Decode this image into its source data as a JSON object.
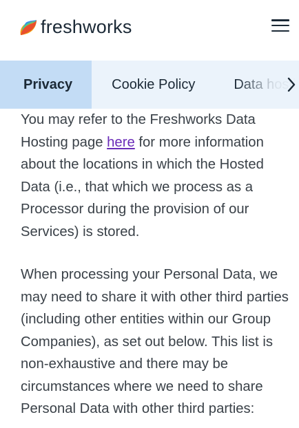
{
  "header": {
    "logo_text": "freshworks",
    "logo_icon": "freshworks-logo-icon",
    "menu_icon": "hamburger-menu-icon"
  },
  "tabs": [
    {
      "label": "Privacy",
      "active": true
    },
    {
      "label": "Cookie Policy",
      "active": false
    },
    {
      "label": "Data hosting",
      "active": false
    }
  ],
  "tab_scroll_icon": "chevron-right-icon",
  "content": {
    "paragraph1": {
      "before_link": "You may refer to the Freshworks Data Hosting page ",
      "link_text": "here",
      "after_link": " for more information about the locations in which the Hosted Data (i.e., that which we process as a Processor during the provision of our Services) is stored."
    },
    "paragraph2": "When processing your Personal Data, we may need to share it with other third parties (including other entities within our Group Companies), as set out below. This list is non-exhaustive and there may be circumstances where we need to share Personal Data with other third parties:"
  },
  "colors": {
    "tab_bar_bg": "#ebf3fb",
    "active_tab_bg": "#c3dcf5",
    "link": "#6a2bb8",
    "text": "#3a4148"
  }
}
